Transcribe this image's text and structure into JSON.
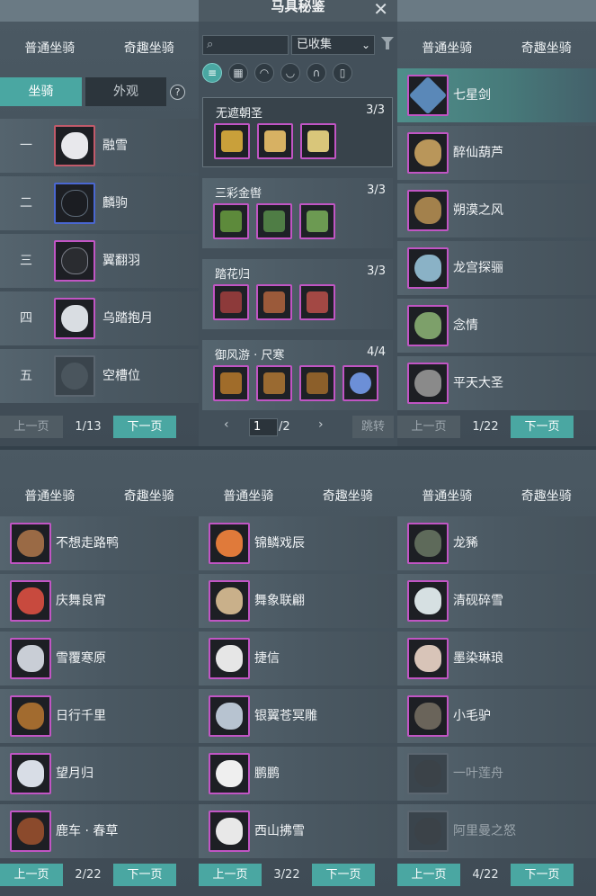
{
  "window": {
    "title": "马具秘鉴",
    "close_icon": "close-icon"
  },
  "categories": [
    "普通坐骑",
    "奇趣坐骑"
  ],
  "left_panel": {
    "subtabs": [
      "坐骑",
      "外观"
    ],
    "help": "?",
    "rows": [
      {
        "num": "一",
        "name": "融雪",
        "color": "#c15a6a"
      },
      {
        "num": "二",
        "name": "麟驹",
        "color": "#3b5fcb"
      },
      {
        "num": "三",
        "name": "翼翻羽",
        "color": "#8a4a8e"
      },
      {
        "num": "四",
        "name": "乌踏抱月",
        "color": "#8a4a8e"
      },
      {
        "num": "五",
        "name": "空槽位",
        "color": "#58646c"
      }
    ],
    "pager": {
      "prev": "上一页",
      "count": "1/13",
      "next": "下一页"
    }
  },
  "middle_panel": {
    "dropdown_value": "已收集",
    "dropdown_icon": "chevron-down-icon",
    "filter_icon": "filter-icon",
    "type_icons": [
      "list-icon",
      "grid-icon",
      "saddle-icon",
      "armor-icon",
      "horseshoe-icon",
      "shield-icon"
    ],
    "sets": [
      {
        "name": "无遮朝圣",
        "count": "3/3",
        "colors": [
          "#c9a03a",
          "#d7b163",
          "#d9c67a"
        ]
      },
      {
        "name": "三彩金辔",
        "count": "3/3",
        "colors": [
          "#5d8a3b",
          "#4f7d45",
          "#6c9a52"
        ]
      },
      {
        "name": "踏花归",
        "count": "3/3",
        "colors": [
          "#8d3a3a",
          "#9b5a3a",
          "#a34844"
        ]
      },
      {
        "name": "御风游 · 尺寒",
        "count": "4/4",
        "colors": [
          "#a06c2a",
          "#9a6a31",
          "#8c5f2a",
          "#6c8fd7"
        ]
      }
    ],
    "pager": {
      "page": "1",
      "total": "/2",
      "prev_icon": "chevron-left-icon",
      "next_icon": "chevron-right-icon",
      "jump": "跳转"
    }
  },
  "right_panel": {
    "rows": [
      {
        "name": "七星剑",
        "color": "#5a88b8"
      },
      {
        "name": "醉仙葫芦",
        "color": "#b9965a"
      },
      {
        "name": "朔漠之风",
        "color": "#a3814c"
      },
      {
        "name": "龙宫探骊",
        "color": "#8ab2c6"
      },
      {
        "name": "念情",
        "color": "#7da06a"
      },
      {
        "name": "平天大圣",
        "color": "#8a8a8a"
      }
    ],
    "pager": {
      "prev": "上一页",
      "count": "1/22",
      "next": "下一页"
    }
  },
  "bottom_panels": [
    {
      "rows": [
        {
          "name": "不想走路鸭",
          "color": "#9a6a45"
        },
        {
          "name": "庆舞良宵",
          "color": "#c84a3e"
        },
        {
          "name": "雪覆寒原",
          "color": "#c9ced6"
        },
        {
          "name": "日行千里",
          "color": "#a26b2f"
        },
        {
          "name": "望月归",
          "color": "#d8dde6"
        },
        {
          "name": "鹿车 · 春草",
          "color": "#8b4a2c"
        }
      ],
      "pager": {
        "prev": "上一页",
        "count": "2/22",
        "next": "下一页"
      }
    },
    {
      "rows": [
        {
          "name": "锦鳞戏辰",
          "color": "#e07a3a"
        },
        {
          "name": "舞象联翩",
          "color": "#c9b08a"
        },
        {
          "name": "捷信",
          "color": "#e6e6e6"
        },
        {
          "name": "银翼苍冥雕",
          "color": "#b7c3d0"
        },
        {
          "name": "鹏鹏",
          "color": "#efefef"
        },
        {
          "name": "西山拂雪",
          "color": "#e8e8e8"
        }
      ],
      "pager": {
        "prev": "上一页",
        "count": "3/22",
        "next": "下一页"
      }
    },
    {
      "rows": [
        {
          "name": "龙豨",
          "color": "#5e6a5a",
          "dim": false
        },
        {
          "name": "清砚碎雪",
          "color": "#d6e0e2",
          "dim": false
        },
        {
          "name": "墨染琳琅",
          "color": "#d8c4b8",
          "dim": false
        },
        {
          "name": "小毛驴",
          "color": "#6a645a",
          "dim": false
        },
        {
          "name": "一叶莲舟",
          "color": "#3b4248",
          "dim": true
        },
        {
          "name": "阿里曼之怒",
          "color": "#3b4248",
          "dim": true
        }
      ],
      "pager": {
        "prev": "上一页",
        "count": "4/22",
        "next": "下一页"
      }
    }
  ]
}
